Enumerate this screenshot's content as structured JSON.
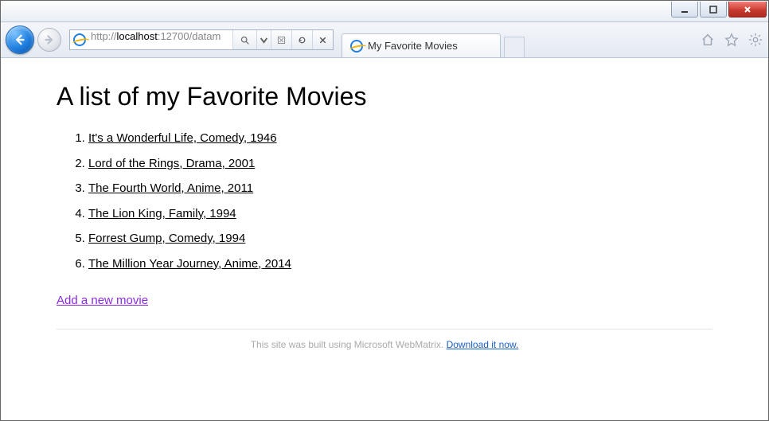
{
  "window": {
    "controls": {
      "minimize": "–",
      "maximize": "☐",
      "close": "✕"
    }
  },
  "toolbar": {
    "url_proto": "http://",
    "url_host": "localhost",
    "url_port": ":12700",
    "url_path": "/datam",
    "tab_title": "My Favorite Movies"
  },
  "page": {
    "heading": "A list of my Favorite Movies",
    "movies": [
      "It's a Wonderful Life, Comedy, 1946",
      "Lord of the Rings, Drama, 2001",
      "The Fourth World, Anime, 2011",
      "The Lion King, Family, 1994",
      "Forrest Gump, Comedy, 1994",
      "The Million Year Journey, Anime, 2014"
    ],
    "add_link": "Add a new movie",
    "footer_text": "This site was built using Microsoft WebMatrix. ",
    "footer_link": "Download it now."
  }
}
